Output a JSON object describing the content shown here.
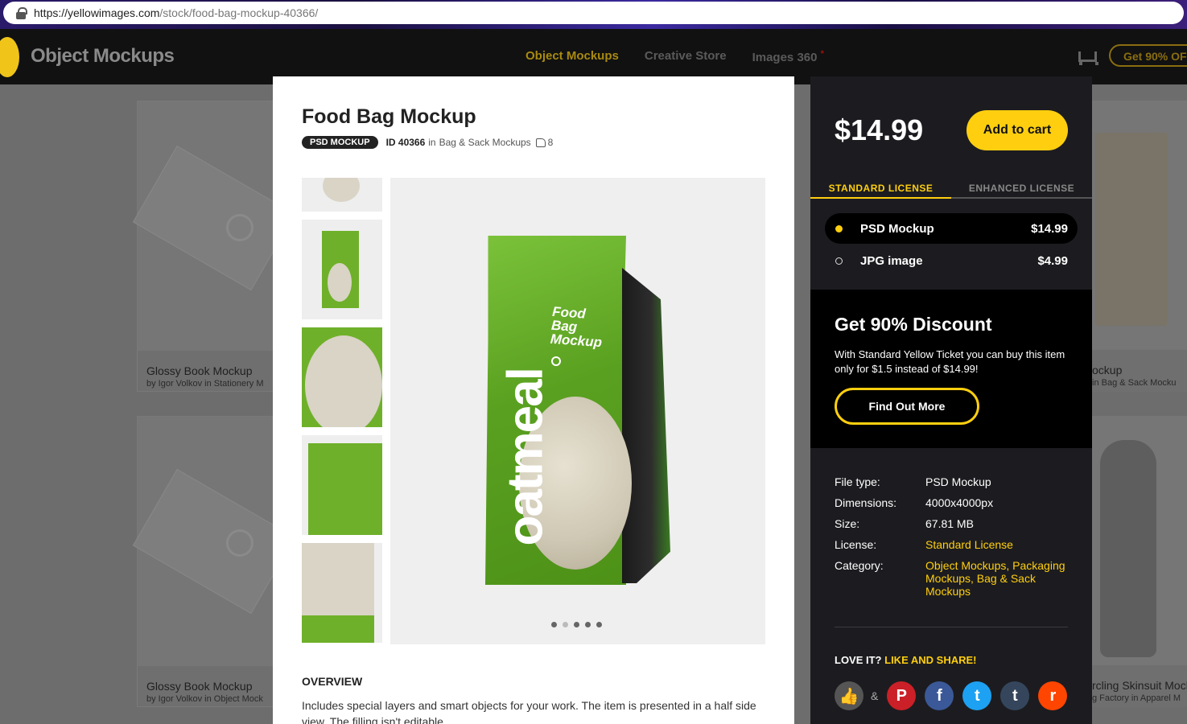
{
  "browser": {
    "url_host": "https://yellowimages.com",
    "url_path": "/stock/food-bag-mockup-40366/"
  },
  "header": {
    "brand": "Object Mockups",
    "nav": [
      {
        "label": "Object Mockups",
        "active": true
      },
      {
        "label": "Creative Store",
        "active": false
      },
      {
        "label": "Images 360",
        "active": false,
        "marker": "*"
      }
    ],
    "promo_label": "Get 90% OF"
  },
  "background_cards": [
    {
      "title": "Glossy Book Mockup",
      "subtitle": "by Igor Volkov in Stationery M"
    },
    {
      "title": "Glossy Book Mockup",
      "subtitle": "by Igor Volkov in Object Mock"
    },
    {
      "title": "ockup",
      "subtitle": "in Bag & Sack Mocku"
    },
    {
      "title": "rcling Skinsuit Mock",
      "subtitle": "g Factory in Apparel M"
    }
  ],
  "product": {
    "title": "Food Bag Mockup",
    "badge": "PSD MOCKUP",
    "id_label": "ID 40366",
    "in_label": "in",
    "category": "Bag & Sack Mockups",
    "likes": "8",
    "bag_word": "oatmeal",
    "bag_brand_line1": "Food",
    "bag_brand_line2": "Bag",
    "bag_brand_line3": "Mockup",
    "carousel_total": 5,
    "carousel_active": 2,
    "overview_heading": "OVERVIEW",
    "overview_text": "Includes special layers and smart objects for your work. The item is presented in a half side view. The filling isn't editable."
  },
  "purchase": {
    "price": "$14.99",
    "add_to_cart": "Add to cart",
    "tabs": [
      {
        "label": "STANDARD LICENSE",
        "active": true
      },
      {
        "label": "ENHANCED LICENSE",
        "active": false
      }
    ],
    "options": [
      {
        "name": "PSD Mockup",
        "price": "$14.99",
        "selected": true
      },
      {
        "name": "JPG image",
        "price": "$4.99",
        "selected": false
      }
    ]
  },
  "discount": {
    "heading": "Get 90% Discount",
    "text": "With Standard Yellow Ticket you can buy this item only for $1.5 instead of $14.99!",
    "button": "Find Out More"
  },
  "details": {
    "file_type_label": "File type:",
    "file_type": "PSD Mockup",
    "dimensions_label": "Dimensions:",
    "dimensions": "4000x4000px",
    "size_label": "Size:",
    "size": "67.81 MB",
    "license_label": "License:",
    "license": "Standard License",
    "category_label": "Category:",
    "category": "Object Mockups, Packaging Mockups, Bag & Sack Mockups"
  },
  "share": {
    "prefix": "LOVE IT?",
    "highlight": "LIKE AND SHARE!",
    "amp": "&",
    "networks": [
      {
        "icon": "like-icon",
        "glyph": "👍",
        "color": "#555555"
      },
      {
        "icon": "pinterest-icon",
        "glyph": "P",
        "color": "#cb2027"
      },
      {
        "icon": "facebook-icon",
        "glyph": "f",
        "color": "#3b5998"
      },
      {
        "icon": "twitter-icon",
        "glyph": "t",
        "color": "#1da1f2"
      },
      {
        "icon": "tumblr-icon",
        "glyph": "t",
        "color": "#35465c"
      },
      {
        "icon": "reddit-icon",
        "glyph": "r",
        "color": "#ff4500"
      }
    ]
  },
  "colors": {
    "accent": "#ffcf0f",
    "panel_bg": "#1c1c20"
  }
}
